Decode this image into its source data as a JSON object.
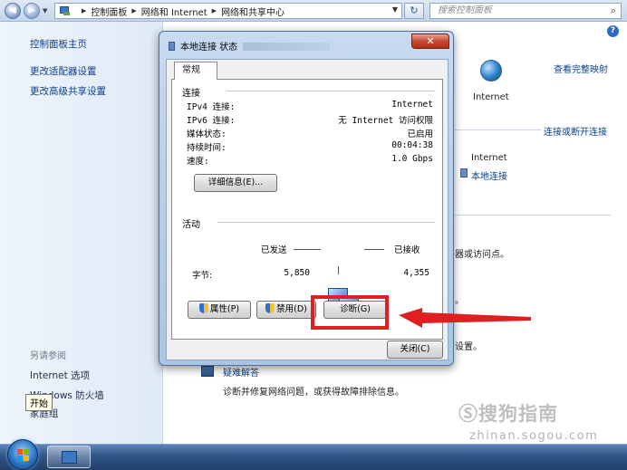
{
  "address_bar": {
    "crumbs": [
      "控制面板",
      "网络和 Internet",
      "网络和共享中心"
    ],
    "search_placeholder": "搜索控制面板"
  },
  "left_pane": {
    "links": [
      "控制面板主页",
      "更改适配器设置",
      "更改高级共享设置"
    ],
    "see_also_title": "另请参阅",
    "see_also": [
      "Internet 选项",
      "Windows 防火墙",
      "家庭组"
    ]
  },
  "main": {
    "view_full_map": "查看完整映射",
    "internet_top": "Internet",
    "connect_disconnect": "连接或断开连接",
    "internet_label": "Internet",
    "local_connection": "本地连接",
    "fragment_router": "器或访问点。",
    "fragment_dot": "。",
    "fragment_settings": "设置。",
    "troubleshoot_title": "疑难解答",
    "troubleshoot_desc": "诊断并修复网络问题，或获得故障排除信息。"
  },
  "dialog": {
    "title": "本地连接 状态",
    "close_glyph": "✕",
    "tab_general": "常规",
    "connection": {
      "title": "连接",
      "rows": [
        {
          "label": "IPv4 连接:",
          "value": "Internet"
        },
        {
          "label": "IPv6 连接:",
          "value": "无 Internet 访问权限"
        },
        {
          "label": "媒体状态:",
          "value": "已启用"
        },
        {
          "label": "持续时间:",
          "value": "00:04:38"
        },
        {
          "label": "速度:",
          "value": "1.0 Gbps"
        }
      ],
      "details_button": "详细信息(E)..."
    },
    "activity": {
      "title": "活动",
      "sent_label": "已发送",
      "received_label": "已接收",
      "bytes_label": "字节:",
      "bytes_sent": "5,850",
      "bytes_received": "4,355"
    },
    "buttons": {
      "properties": "属性(P)",
      "disable": "禁用(D)",
      "diagnose": "诊断(G)",
      "close": "关闭(C)"
    }
  },
  "taskbar": {
    "start_tooltip": "开始"
  },
  "watermark": {
    "brand": "搜狗指南",
    "url": "zhinan.sogou.com"
  },
  "colors": {
    "link": "#0b3f8a",
    "annotation": "#e02020",
    "taskbar": "#2f5486"
  }
}
